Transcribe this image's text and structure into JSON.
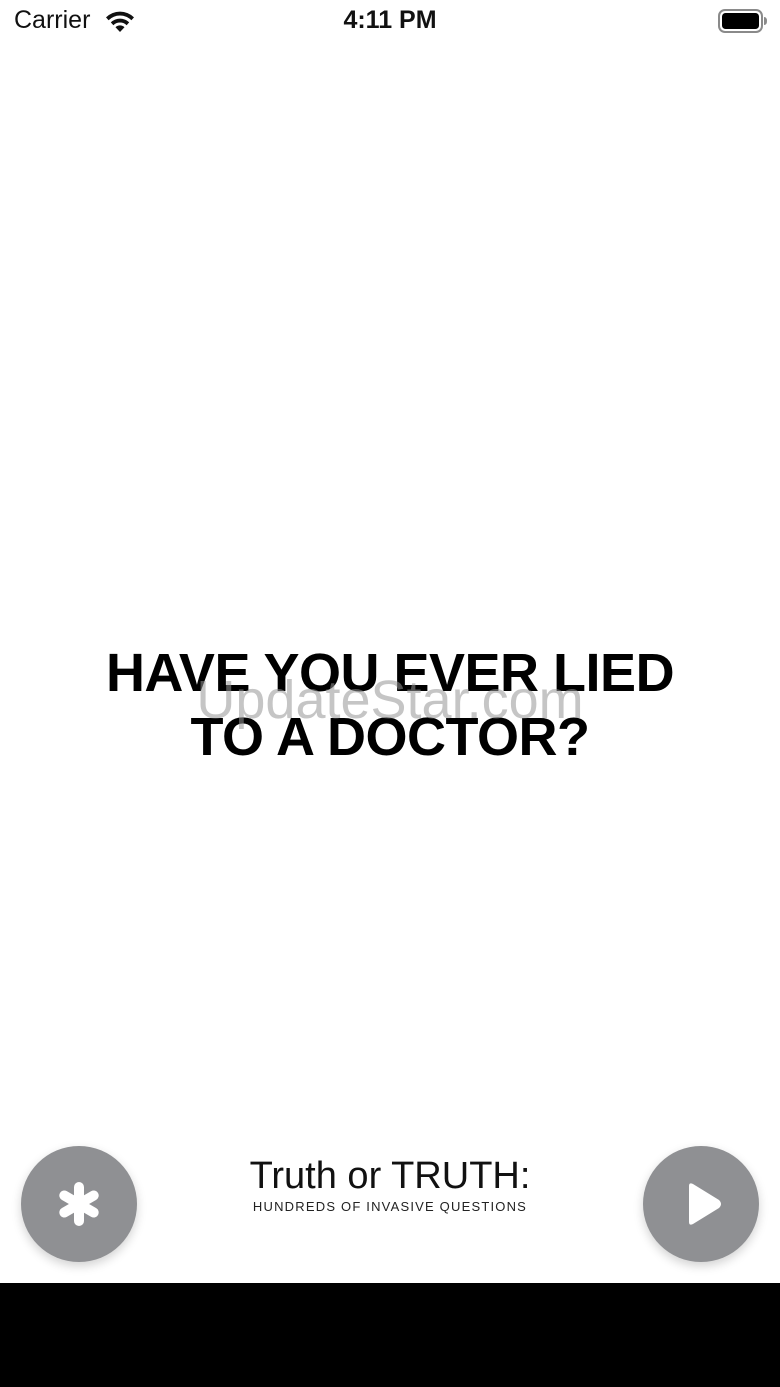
{
  "status_bar": {
    "carrier": "Carrier",
    "time": "4:11 PM",
    "wifi_icon": "wifi-icon",
    "battery_icon": "battery-icon"
  },
  "question": {
    "line1": "HAVE YOU EVER LIED",
    "line2": "TO A DOCTOR?"
  },
  "watermark": "UpdateStar.com",
  "bottom_bar": {
    "settings_icon": "asterisk-icon",
    "play_icon": "play-icon",
    "button_color": "#8f9093",
    "brand_title": "Truth or TRUTH:",
    "brand_subtitle": "HUNDREDS OF INVASIVE QUESTIONS"
  }
}
